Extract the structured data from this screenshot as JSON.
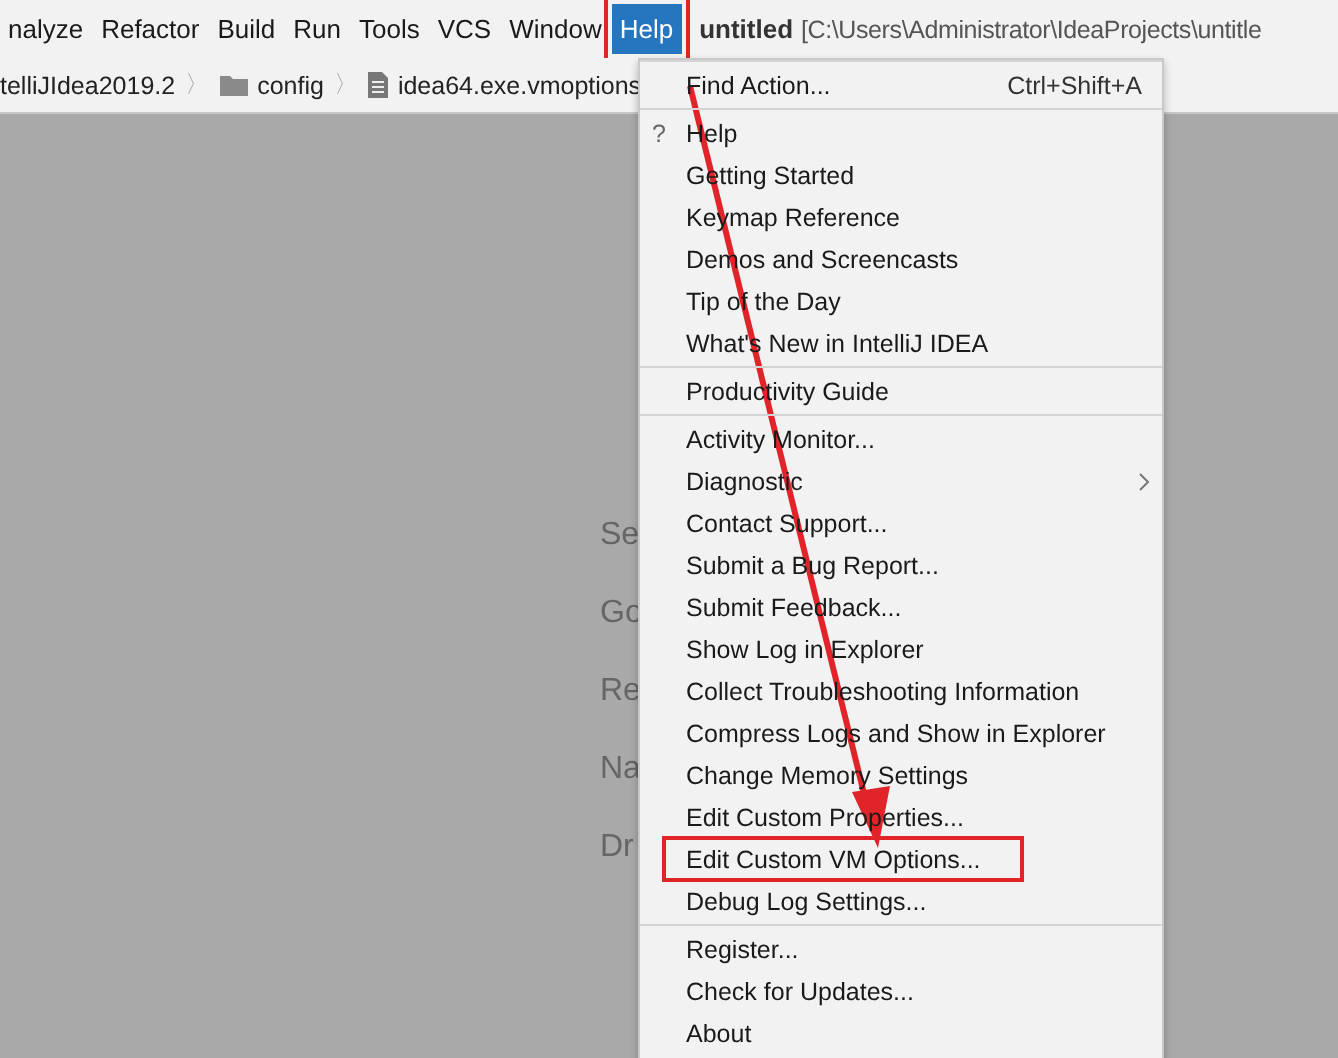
{
  "menubar": [
    {
      "label": "nalyze",
      "selected": false,
      "annotated": false
    },
    {
      "label": "Refactor",
      "selected": false,
      "annotated": false
    },
    {
      "label": "Build",
      "selected": false,
      "annotated": false
    },
    {
      "label": "Run",
      "selected": false,
      "annotated": false
    },
    {
      "label": "Tools",
      "selected": false,
      "annotated": false
    },
    {
      "label": "VCS",
      "selected": false,
      "annotated": false
    },
    {
      "label": "Window",
      "selected": false,
      "annotated": false
    },
    {
      "label": "Help",
      "selected": true,
      "annotated": true
    }
  ],
  "window": {
    "project": "untitled",
    "path": "[C:\\Users\\Administrator\\IdeaProjects\\untitle"
  },
  "breadcrumbs": [
    {
      "label": "telliJIdea2019.2",
      "kind": "text"
    },
    {
      "label": "config",
      "kind": "folder",
      "separator": "〉"
    },
    {
      "label": "idea64.exe.vmoptions",
      "kind": "file",
      "separator": "〉"
    }
  ],
  "background_hints": [
    "Se",
    "Go",
    "Re",
    "Na",
    "Dr"
  ],
  "help_menu": {
    "groups": [
      [
        {
          "label": "Find Action...",
          "shortcut": "Ctrl+Shift+A",
          "kind": "plain",
          "annotated": false
        }
      ],
      [
        {
          "label": "Help",
          "kind": "help",
          "icon": "?",
          "annotated": false
        },
        {
          "label": "Getting Started",
          "kind": "plain",
          "annotated": false
        },
        {
          "label": "Keymap Reference",
          "kind": "plain",
          "annotated": false
        },
        {
          "label": "Demos and Screencasts",
          "kind": "plain",
          "annotated": false
        },
        {
          "label": "Tip of the Day",
          "kind": "plain",
          "annotated": false
        },
        {
          "label": "What's New in IntelliJ IDEA",
          "kind": "plain",
          "annotated": false
        }
      ],
      [
        {
          "label": "Productivity Guide",
          "kind": "plain",
          "annotated": false
        }
      ],
      [
        {
          "label": "Activity Monitor...",
          "kind": "plain",
          "annotated": false
        },
        {
          "label": "Diagnostic",
          "kind": "submenu",
          "annotated": false
        },
        {
          "label": "Contact Support...",
          "kind": "plain",
          "annotated": false
        },
        {
          "label": "Submit a Bug Report...",
          "kind": "plain",
          "annotated": false
        },
        {
          "label": "Submit Feedback...",
          "kind": "plain",
          "annotated": false
        },
        {
          "label": "Show Log in Explorer",
          "kind": "plain",
          "annotated": false
        },
        {
          "label": "Collect Troubleshooting Information",
          "kind": "plain",
          "annotated": false
        },
        {
          "label": "Compress Logs and Show in Explorer",
          "kind": "plain",
          "annotated": false
        },
        {
          "label": "Change Memory Settings",
          "kind": "plain",
          "annotated": false
        },
        {
          "label": "Edit Custom Properties...",
          "kind": "plain",
          "annotated": false
        },
        {
          "label": "Edit Custom VM Options...",
          "kind": "plain",
          "annotated": true
        },
        {
          "label": "Debug Log Settings...",
          "kind": "plain",
          "annotated": false
        }
      ],
      [
        {
          "label": "Register...",
          "kind": "plain",
          "annotated": false
        },
        {
          "label": "Check for Updates...",
          "kind": "plain",
          "annotated": false
        },
        {
          "label": "About",
          "kind": "plain",
          "annotated": false
        }
      ]
    ]
  }
}
